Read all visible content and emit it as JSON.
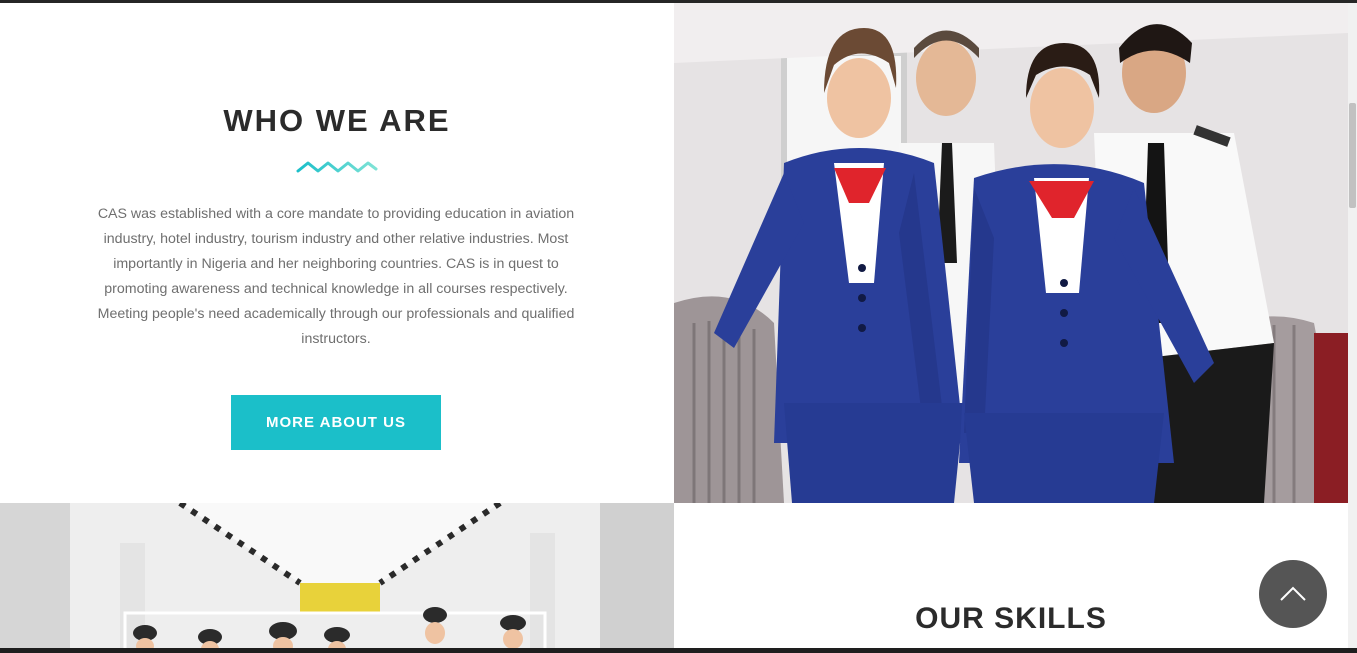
{
  "about": {
    "title": "WHO WE ARE",
    "text": "CAS was established with a core mandate to providing education in aviation industry, hotel industry, tourism industry and other relative industries. Most importantly in Nigeria and her neighboring countries. CAS is in quest to promoting awareness and technical knowledge in all courses respectively. Meeting people's need academically through our professionals and qualified instructors.",
    "button_label": "MORE ABOUT US"
  },
  "skills": {
    "title": "OUR SKILLS"
  },
  "icons": {
    "divider": "zigzag-divider-icon",
    "back_to_top": "chevron-up-icon"
  },
  "colors": {
    "accent": "#1bbfc9",
    "zigzag_start": "#1bbfc9",
    "zigzag_end": "#7fe3d6",
    "heading": "#2b2b2b",
    "body_text": "#6f6f6f",
    "to_top_bg": "#555555"
  }
}
